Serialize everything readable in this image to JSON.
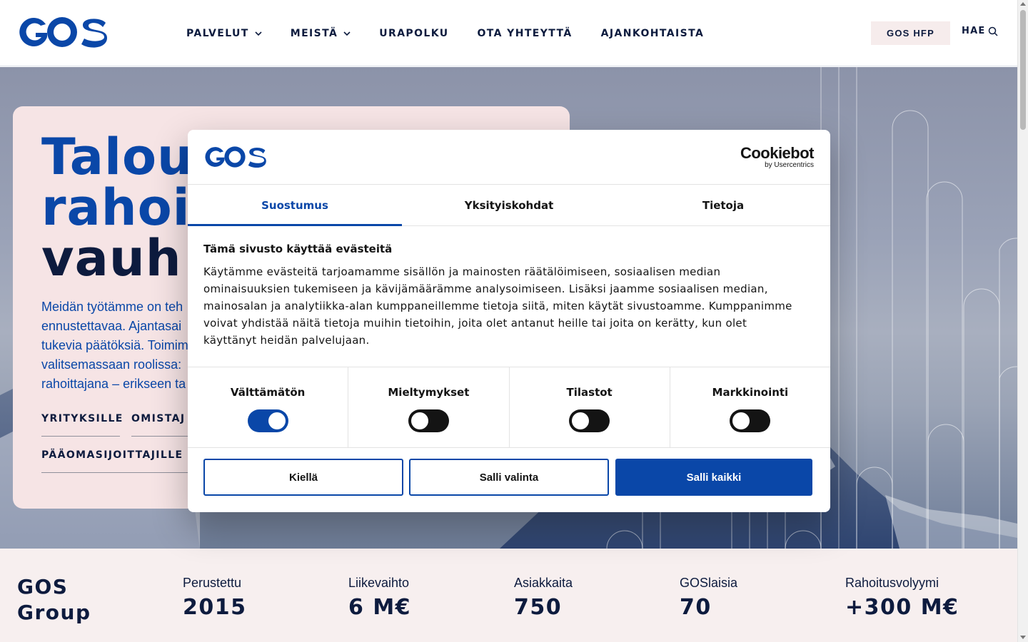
{
  "header": {
    "logo_text": "GOS",
    "nav": [
      {
        "label": "PALVELUT",
        "has_dropdown": true
      },
      {
        "label": "MEISTÄ",
        "has_dropdown": true
      },
      {
        "label": "URAPOLKU",
        "has_dropdown": false
      },
      {
        "label": "OTA YHTEYTTÄ",
        "has_dropdown": false
      },
      {
        "label": "AJANKOHTAISTA",
        "has_dropdown": false
      }
    ],
    "hfp_button": "GOS HFP",
    "search_label": "HAE"
  },
  "hero": {
    "title_line1": "Talou",
    "title_line2": "rahoi",
    "title_line3": "vauh",
    "text_lines": [
      "Meidän työtämme on teh",
      "ennustettavaa. Ajantasai",
      "tukevia päätöksiä. Toimim",
      "valitsemassaan roolissa: ",
      "rahoittajana – erikseen ta"
    ],
    "links": [
      "YRITYKSILLE",
      "OMISTAJ",
      "PÄÄOMASIJOITTAJILLE"
    ]
  },
  "stats": {
    "title_line1": "GOS",
    "title_line2": "Group",
    "items": [
      {
        "label": "Perustettu",
        "value": "2015"
      },
      {
        "label": "Liikevaihto",
        "value": "6 M€"
      },
      {
        "label": "Asiakkaita",
        "value": "750"
      },
      {
        "label": "GOSlaisia",
        "value": "70"
      },
      {
        "label": "Rahoitusvolyymi",
        "value": "+300 M€"
      }
    ]
  },
  "cookie_dialog": {
    "logo_text": "GOS",
    "brand": "Cookiebot",
    "brand_sub": "by Usercentrics",
    "tabs": [
      {
        "label": "Suostumus",
        "active": true
      },
      {
        "label": "Yksityiskohdat",
        "active": false
      },
      {
        "label": "Tietoja",
        "active": false
      }
    ],
    "heading": "Tämä sivusto käyttää evästeitä",
    "body_lines": [
      "Käytämme evästeitä tarjoamamme sisällön ja mainosten räätälöimiseen, sosiaalisen median",
      "ominaisuuksien tukemiseen ja kävijämäärämme analysoimiseen. Lisäksi jaamme sosiaalisen median,",
      "mainosalan ja analytiikka-alan kumppaneillemme tietoja siitä, miten käytät sivustoamme. Kumppanimme",
      "voivat yhdistää näitä tietoja muihin tietoihin, joita olet antanut heille tai joita on kerätty, kun olet",
      "käyttänyt heidän palvelujaan."
    ],
    "toggles": [
      {
        "label": "Välttämätön",
        "on": true
      },
      {
        "label": "Mieltymykset",
        "on": false
      },
      {
        "label": "Tilastot",
        "on": false
      },
      {
        "label": "Markkinointi",
        "on": false
      }
    ],
    "buttons": {
      "deny": "Kiellä",
      "allow_selection": "Salli valinta",
      "allow_all": "Salli kaikki"
    }
  },
  "colors": {
    "brand_blue": "#0a47a8",
    "navy": "#0d1b3e",
    "card_pink": "#f6e4e5",
    "stats_bg": "#f7efef"
  }
}
